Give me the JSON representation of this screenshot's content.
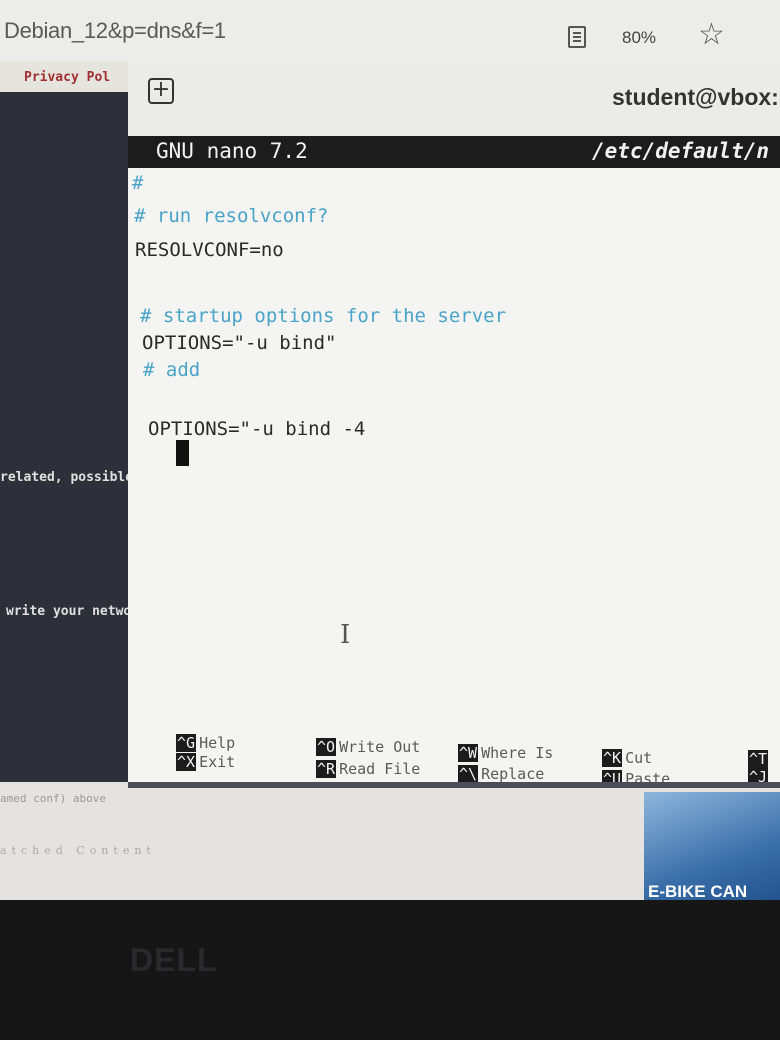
{
  "browser": {
    "url": "Debian_12&p=dns&f=1",
    "zoom": "80%",
    "reader_icon": "reader-mode-icon",
    "bookmark_icon": "star-icon"
  },
  "background_page": {
    "privacy_link": "Privacy Pol",
    "text_related": "related, possible",
    "text_network": "write your network",
    "text_conf": "amed conf) above",
    "text_content": "atched Content",
    "ad_text": "E-BIKE CAN"
  },
  "terminal": {
    "title": "student@vbox:",
    "new_tab_icon": "plus-icon",
    "nano_version": "GNU nano 7.2",
    "filename": "/etc/default/n",
    "lines": [
      {
        "text": "#",
        "kind": "comment"
      },
      {
        "text": "# run resolvconf?",
        "kind": "comment"
      },
      {
        "text": "RESOLVCONF=no",
        "kind": "code"
      },
      {
        "text": "# startup options for the server",
        "kind": "comment"
      },
      {
        "text": "OPTIONS=\"-u bind\"",
        "kind": "code"
      },
      {
        "text": "# add",
        "kind": "comment"
      },
      {
        "text": "OPTIONS=\"-u bind -4",
        "kind": "code"
      }
    ],
    "shortcuts": [
      {
        "key": "^G",
        "label": "Help"
      },
      {
        "key": "^X",
        "label": "Exit"
      },
      {
        "key": "^O",
        "label": "Write Out"
      },
      {
        "key": "^R",
        "label": "Read File"
      },
      {
        "key": "^W",
        "label": "Where Is"
      },
      {
        "key": "^\\",
        "label": "Replace"
      },
      {
        "key": "^K",
        "label": "Cut"
      },
      {
        "key": "^U",
        "label": "Paste"
      },
      {
        "key": "^T",
        "label": ""
      },
      {
        "key": "^J",
        "label": ""
      }
    ]
  },
  "monitor": {
    "brand": "DELL"
  },
  "colors": {
    "comment": "#4aa3c8",
    "titlebar": "#1c1c1c",
    "editor_bg": "#f4f4f2"
  }
}
